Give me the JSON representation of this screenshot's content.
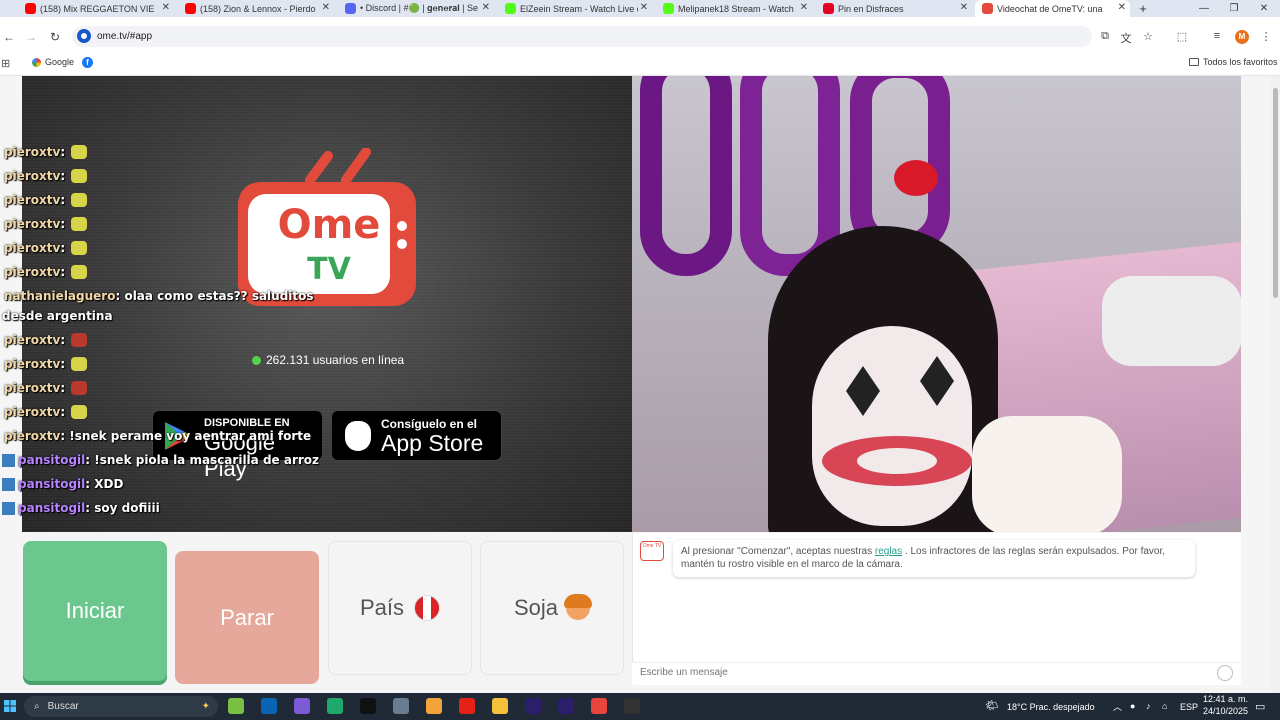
{
  "browser": {
    "tabs": [
      {
        "title": "(158) Mix REGGAETON VIE",
        "icon_color": "#ff0000"
      },
      {
        "title": "(158) Zion & Lennox - Pierdo La",
        "icon_color": "#ff0000"
      },
      {
        "title": "• Discord | #🟢 | 𝐠𝐞𝐧𝐞𝐫𝐚𝐥 | Serv",
        "icon_color": "#5865f2"
      },
      {
        "title": "ElZeein Stream - Watch Live on",
        "icon_color": "#53fc18"
      },
      {
        "title": "Melipanek18 Stream - Watch Li",
        "icon_color": "#53fc18"
      },
      {
        "title": "Pin en Disfraces",
        "icon_color": "#e60023"
      },
      {
        "title": "Videochat de OmeTV: una",
        "icon_color": "#e24a3b"
      }
    ],
    "url": "ome.tv/#app",
    "profile_initial": "M",
    "bookmarks": [
      "Google"
    ],
    "all_bookmarks": "Todos los favoritos"
  },
  "chat_overlay": [
    {
      "user": "pieroxtv",
      "text": " :",
      "emote": "frog",
      "user_color": "gold"
    },
    {
      "user": "pieroxtv",
      "text": " :",
      "emote": "frog",
      "user_color": "gold"
    },
    {
      "user": "pieroxtv",
      "text": " :",
      "emote": "frog",
      "user_color": "gold"
    },
    {
      "user": "pieroxtv",
      "text": " :",
      "emote": "frog",
      "user_color": "gold"
    },
    {
      "user": "pieroxtv",
      "text": " :",
      "emote": "frog",
      "user_color": "gold"
    },
    {
      "user": "pieroxtv",
      "text": " :",
      "emote": "frog",
      "user_color": "gold"
    },
    {
      "user": "nathanielaguero",
      "text": " : olaa como estas?? saluditos",
      "emote": "",
      "user_color": "gold"
    },
    {
      "user": "",
      "text": "desde argentina",
      "emote": "",
      "user_color": "gold"
    },
    {
      "user": "pieroxtv",
      "text": " :",
      "emote": "red",
      "user_color": "gold"
    },
    {
      "user": "pieroxtv",
      "text": " :",
      "emote": "frog",
      "user_color": "gold"
    },
    {
      "user": "pieroxtv",
      "text": " :",
      "emote": "red",
      "user_color": "gold"
    },
    {
      "user": "pieroxtv",
      "text": " :",
      "emote": "frog",
      "user_color": "gold"
    },
    {
      "user": "pieroxtv",
      "text": " : !snek perame voy aentrar ami forte",
      "emote": "",
      "user_color": "gold"
    },
    {
      "user": "pansitogil",
      "text": " : !snek piola la mascarilla de arroz",
      "emote": "",
      "user_color": "purple",
      "badge": true
    },
    {
      "user": "pansitogil",
      "text": " : XDD",
      "emote": "",
      "user_color": "purple",
      "badge": true
    },
    {
      "user": "pansitogil",
      "text": " : soy dofiiii",
      "emote": "",
      "user_color": "purple",
      "badge": true
    }
  ],
  "ometv": {
    "logo_top": "Ome",
    "logo_bottom": "TV",
    "online_count": "262.131 usuarios en línea",
    "google_play_small": "DISPONIBLE EN",
    "google_play_big": "Google Play",
    "app_store_small": "Consíguelo en el",
    "app_store_big": "App Store"
  },
  "controls": {
    "start": "Iniciar",
    "stop": "Parar",
    "country": "País",
    "gender": "Soja"
  },
  "chat_panel": {
    "icon_text": "Ome TV",
    "system_msg_before": "Al presionar \"Comenzar\", aceptas nuestras ",
    "system_msg_link": "reglas",
    "system_msg_after": " . Los infractores de las reglas serán expulsados. Por favor, mantén tu rostro visible en el marco de la cámara.",
    "input_placeholder": "Escribe un mensaje"
  },
  "taskbar": {
    "search": "Buscar",
    "weather": "18°C  Prac. despejado",
    "lang": "ESP",
    "time": "12:41 a. m.",
    "date": "24/10/2025"
  }
}
